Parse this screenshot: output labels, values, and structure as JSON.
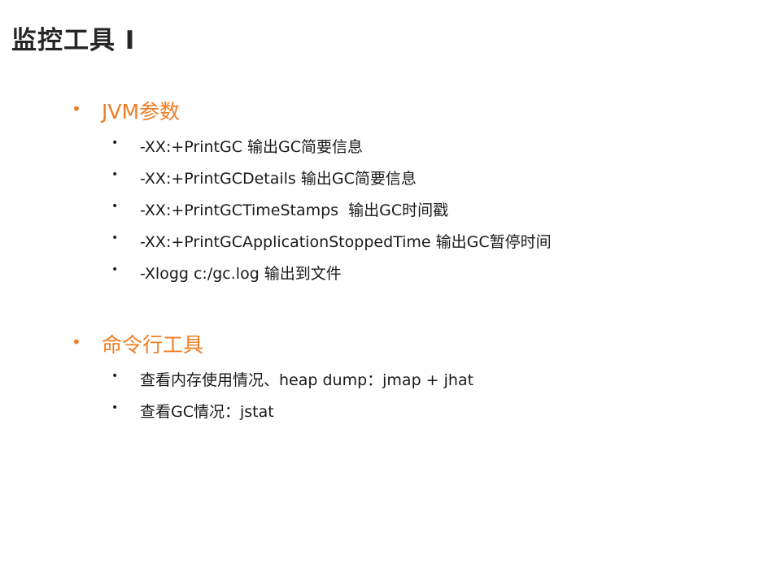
{
  "slide": {
    "title": "监控工具 I"
  },
  "sections": [
    {
      "heading": "JVM参数",
      "items": [
        "-XX:+PrintGC 输出GC简要信息",
        "-XX:+PrintGCDetails 输出GC简要信息",
        "-XX:+PrintGCTimeStamps  输出GC时间戳",
        "-XX:+PrintGCApplicationStoppedTime 输出GC暂停时间",
        "-Xlogg c:/gc.log 输出到文件"
      ]
    },
    {
      "heading": "命令行工具",
      "items": [
        "查看内存使用情况、heap dump：jmap + jhat",
        "查看GC情况：jstat"
      ]
    }
  ],
  "colors": {
    "accent": "#ef7d22",
    "title": "#262626",
    "text": "#1a1a1a"
  }
}
